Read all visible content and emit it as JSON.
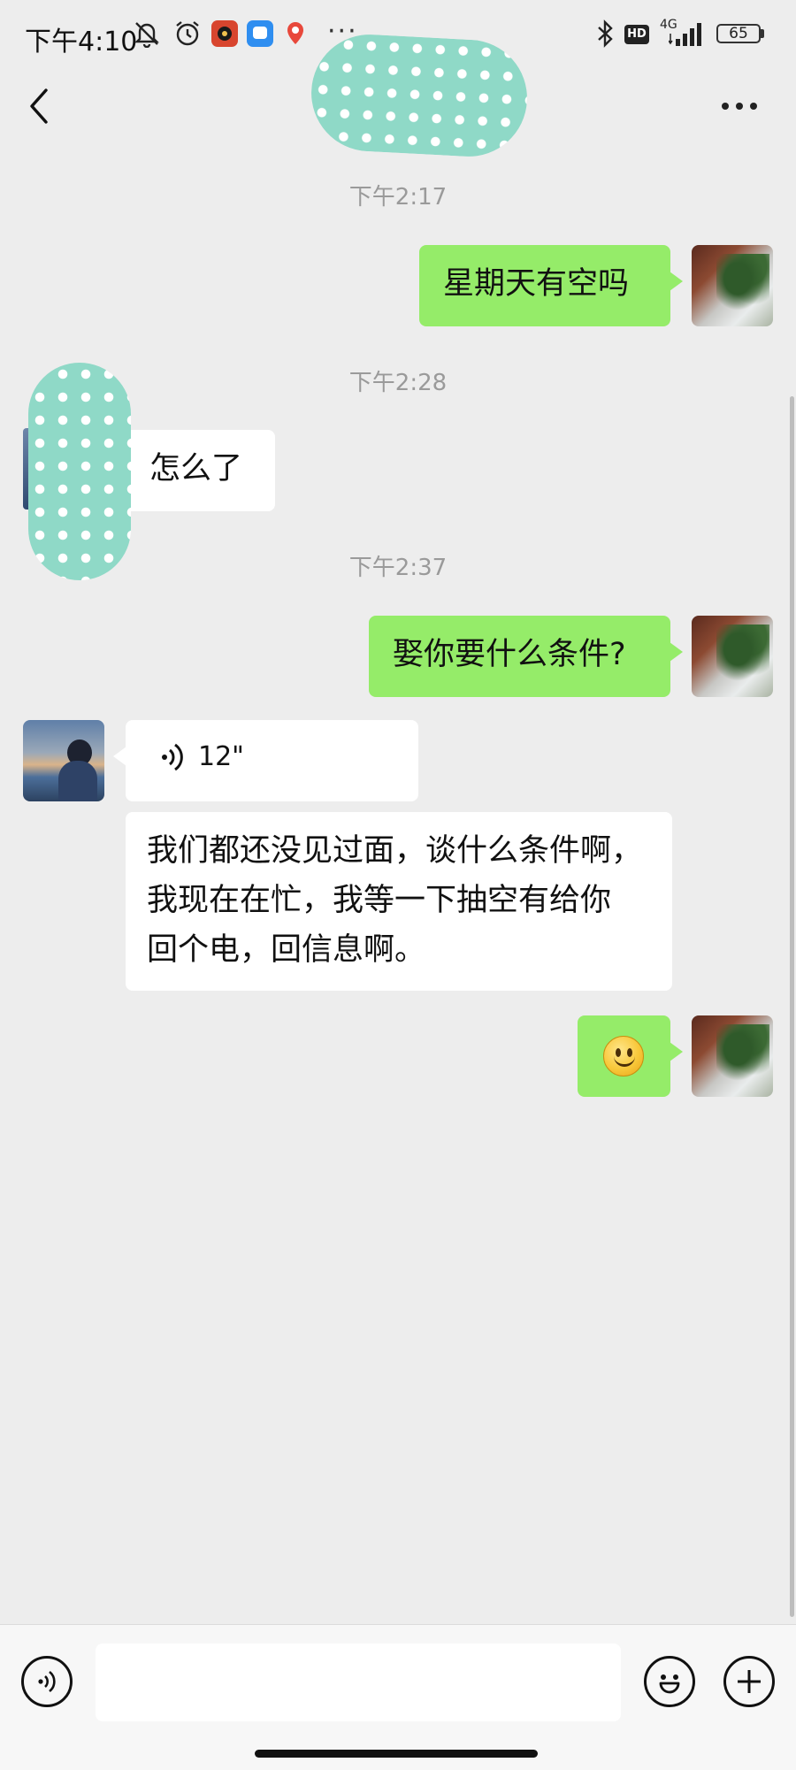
{
  "status_bar": {
    "time": "下午4:10",
    "network": "4G",
    "hd": "HD",
    "battery": "65",
    "more": "···"
  },
  "header": {
    "back_icon": "chevron-left-icon",
    "more_icon": "more-horizontal-icon"
  },
  "messages": [
    {
      "type": "timestamp",
      "text": "下午2:17"
    },
    {
      "type": "text",
      "from": "self",
      "text": "星期天有空吗"
    },
    {
      "type": "timestamp",
      "text": "下午2:28"
    },
    {
      "type": "text",
      "from": "other",
      "text": "怎么了"
    },
    {
      "type": "timestamp",
      "text": "下午2:37"
    },
    {
      "type": "text",
      "from": "self",
      "text": "娶你要什么条件?"
    },
    {
      "type": "voice",
      "from": "other",
      "duration": "12\""
    },
    {
      "type": "text",
      "from": "other",
      "text": "我们都还没见过面，谈什么条件啊，\n我现在在忙，我等一下抽空有给你\n回个电，回信息啊。"
    },
    {
      "type": "emoji",
      "from": "self",
      "emoji": "smiley-emoji"
    }
  ],
  "input_bar": {
    "placeholder": "",
    "voice_icon": "voice-mode-icon",
    "emoji_icon": "emoji-icon",
    "plus_icon": "plus-icon"
  },
  "colors": {
    "background": "#ededed",
    "self_bubble": "#95ec69",
    "other_bubble": "#ffffff",
    "timestamp": "#9a9a9a"
  }
}
